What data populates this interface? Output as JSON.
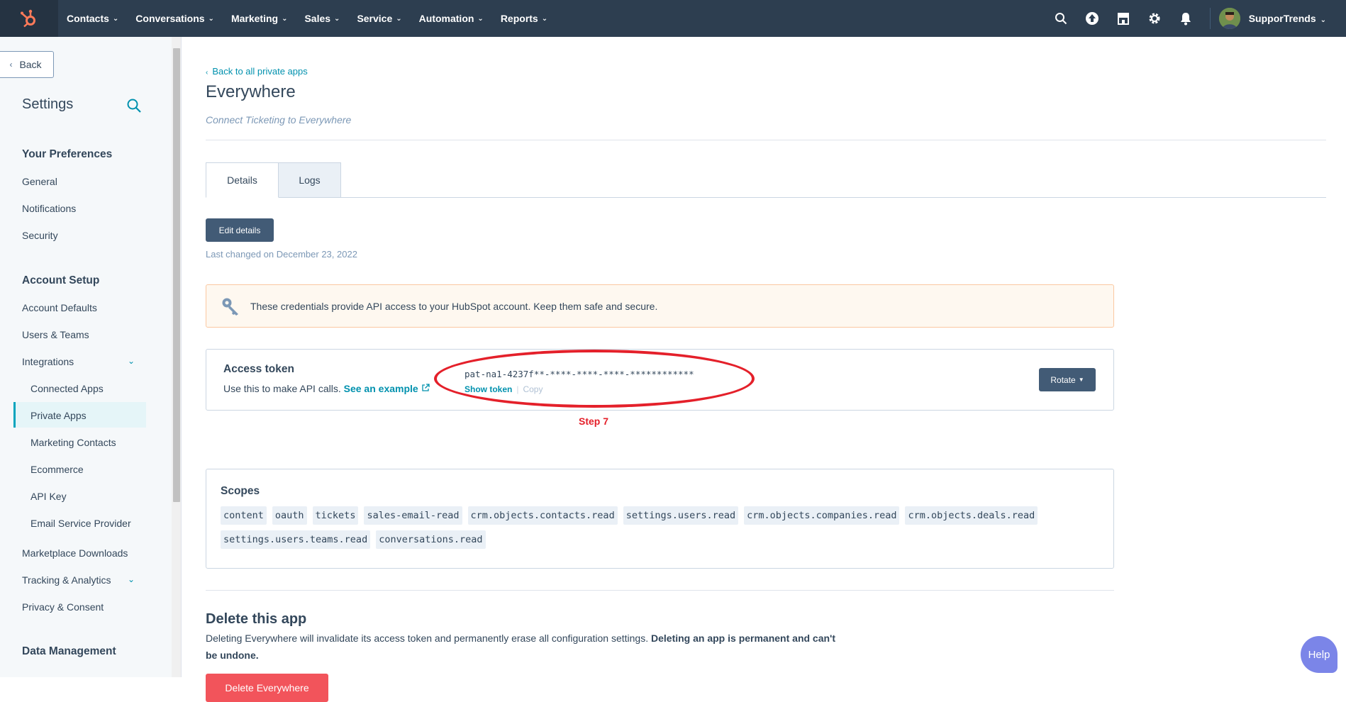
{
  "topnav": {
    "items": [
      {
        "label": "Contacts"
      },
      {
        "label": "Conversations"
      },
      {
        "label": "Marketing"
      },
      {
        "label": "Sales"
      },
      {
        "label": "Service"
      },
      {
        "label": "Automation"
      },
      {
        "label": "Reports"
      }
    ],
    "account_name": "SupporTrends",
    "icons": [
      "search-icon",
      "upgrade-icon",
      "marketplace-icon",
      "gear-icon",
      "bell-icon"
    ],
    "brand_color": "#ff7a59"
  },
  "sidebar": {
    "back_label": "Back",
    "title": "Settings",
    "sections": [
      {
        "heading": "Your Preferences",
        "items": [
          "General",
          "Notifications",
          "Security"
        ]
      },
      {
        "heading": "Account Setup",
        "items": [
          "Account Defaults",
          "Users & Teams",
          "Integrations"
        ]
      },
      {
        "sub_items": [
          "Connected Apps",
          "Private Apps",
          "Marketing Contacts",
          "Ecommerce",
          "API Key",
          "Email Service Provider"
        ]
      },
      {
        "items": [
          "Marketplace Downloads",
          "Tracking & Analytics",
          "Privacy & Consent"
        ]
      },
      {
        "heading": "Data Management"
      }
    ],
    "active_item": "Private Apps"
  },
  "main": {
    "back_link": "Back to all private apps",
    "title": "Everywhere",
    "subtitle": "Connect Ticketing to Everywhere",
    "tabs": [
      {
        "label": "Details"
      },
      {
        "label": "Logs"
      }
    ],
    "edit_button": "Edit details",
    "last_changed": "Last changed on December 23, 2022",
    "alert": "These credentials provide API access to your HubSpot account. Keep them safe and secure.",
    "token": {
      "title": "Access token",
      "description": "Use this to make API calls.",
      "example_link": "See an example",
      "value": "pat-na1-4237f**-****-****-****-************",
      "show_token": "Show token",
      "copy": "Copy",
      "rotate": "Rotate"
    },
    "annotation": "Step 7",
    "scopes": {
      "title": "Scopes",
      "items": [
        "content",
        "oauth",
        "tickets",
        "sales-email-read",
        "crm.objects.contacts.read",
        "settings.users.read",
        "crm.objects.companies.read",
        "crm.objects.deals.read",
        "settings.users.teams.read",
        "conversations.read"
      ]
    },
    "delete": {
      "title": "Delete this app",
      "text": "Deleting Everywhere will invalidate its access token and permanently erase all configuration settings.",
      "text_bold": "Deleting an app is permanent and can't be undone.",
      "button": "Delete Everywhere"
    }
  },
  "help_label": "Help"
}
